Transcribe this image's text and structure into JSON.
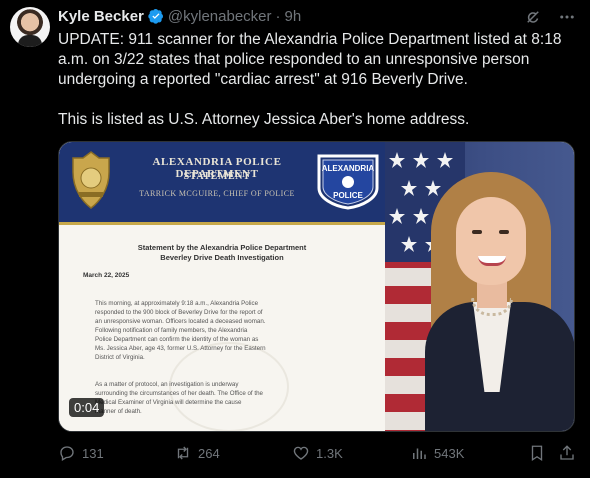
{
  "author": {
    "name": "Kyle Becker",
    "handle": "@kylenabecker",
    "separator": "·",
    "time": "9h"
  },
  "tweet": {
    "text": "UPDATE: 911 scanner for the Alexandria Police Department listed at 8:18 a.m. on 3/22 states that police responded to an unresponsive person undergoing a reported \"cardiac arrest\" at 916 Beverly Drive.\n\nThis is listed as U.S. Attorney Jessica Aber's home address."
  },
  "media": {
    "duration": "0:04",
    "document": {
      "banner_title": "ALEXANDRIA POLICE DEPARTMENT",
      "banner_subtitle": "STATEMENT",
      "banner_chief": "TARRICK MCGUIRE, CHIEF OF POLICE",
      "badge_text": "ALEXANDRIA POLICE",
      "heading_line1": "Statement by the Alexandria Police Department",
      "heading_line2": "Beverley Drive Death Investigation",
      "date": "March 22, 2025",
      "paragraph1": "This morning, at approximately 9:18 a.m., Alexandria Police\nresponded to the 900 block of Beverley Drive for the report of\nan unresponsive woman. Officers located a deceased woman.\nFollowing notification of family members, the Alexandria\nPolice Department can confirm the identity of the woman as\nMs. Jessica Aber, age 43, former U.S. Attorney for the Eastern\nDistrict of Virginia.",
      "paragraph2": "As a matter of protocol, an investigation is underway\nsurrounding the circumstances of her death. The Office of the\nMedical Examiner of Virginia will determine the cause\nmanner of death."
    }
  },
  "actions": {
    "replies": "131",
    "reposts": "264",
    "likes": "1.3K",
    "views": "543K"
  },
  "colors": {
    "background": "#000000",
    "text": "#e7e9ea",
    "muted": "#71767b",
    "verified": "#1d9bf0",
    "police_blue": "#1e3472"
  }
}
